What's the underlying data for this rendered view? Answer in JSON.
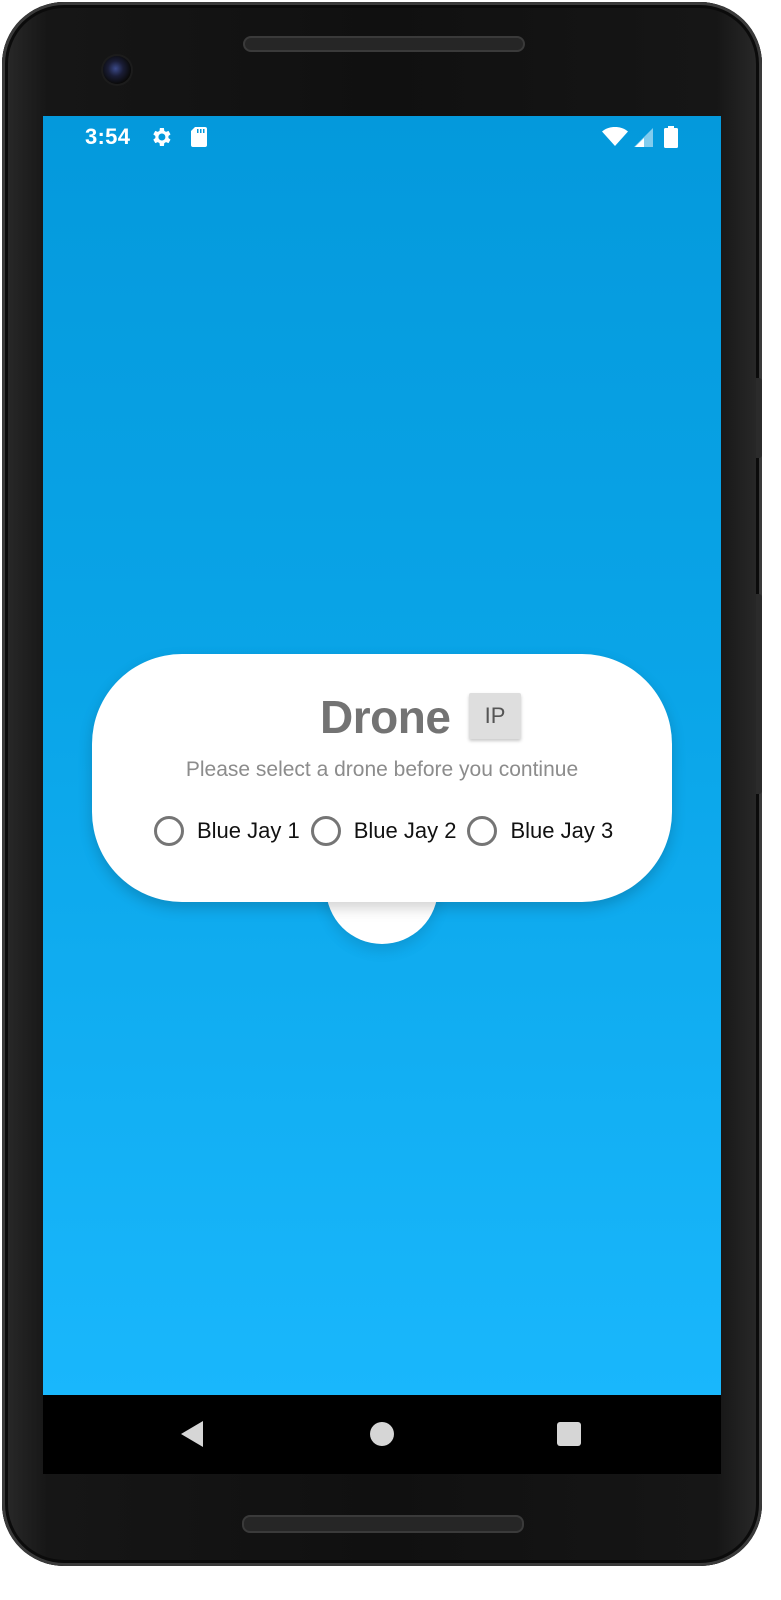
{
  "status_bar": {
    "time": "3:54",
    "icons": [
      "gear-icon",
      "sd-card-icon",
      "wifi-icon",
      "signal-icon",
      "battery-icon"
    ]
  },
  "card": {
    "title": "Drone",
    "ip_button_label": "IP",
    "subtitle": "Please select a drone before you continue",
    "options": [
      {
        "label": "Blue Jay 1",
        "selected": false
      },
      {
        "label": "Blue Jay 2",
        "selected": false
      },
      {
        "label": "Blue Jay 3",
        "selected": false
      }
    ]
  },
  "nav_bar": {
    "icons": [
      "back-icon",
      "home-icon",
      "recent-apps-icon"
    ]
  },
  "colors": {
    "background_top": "#0499dc",
    "background_bottom": "#19b7fc",
    "card": "#ffffff",
    "title": "#737373",
    "subtitle": "#8c8c8c",
    "ip_button": "#dedede"
  }
}
